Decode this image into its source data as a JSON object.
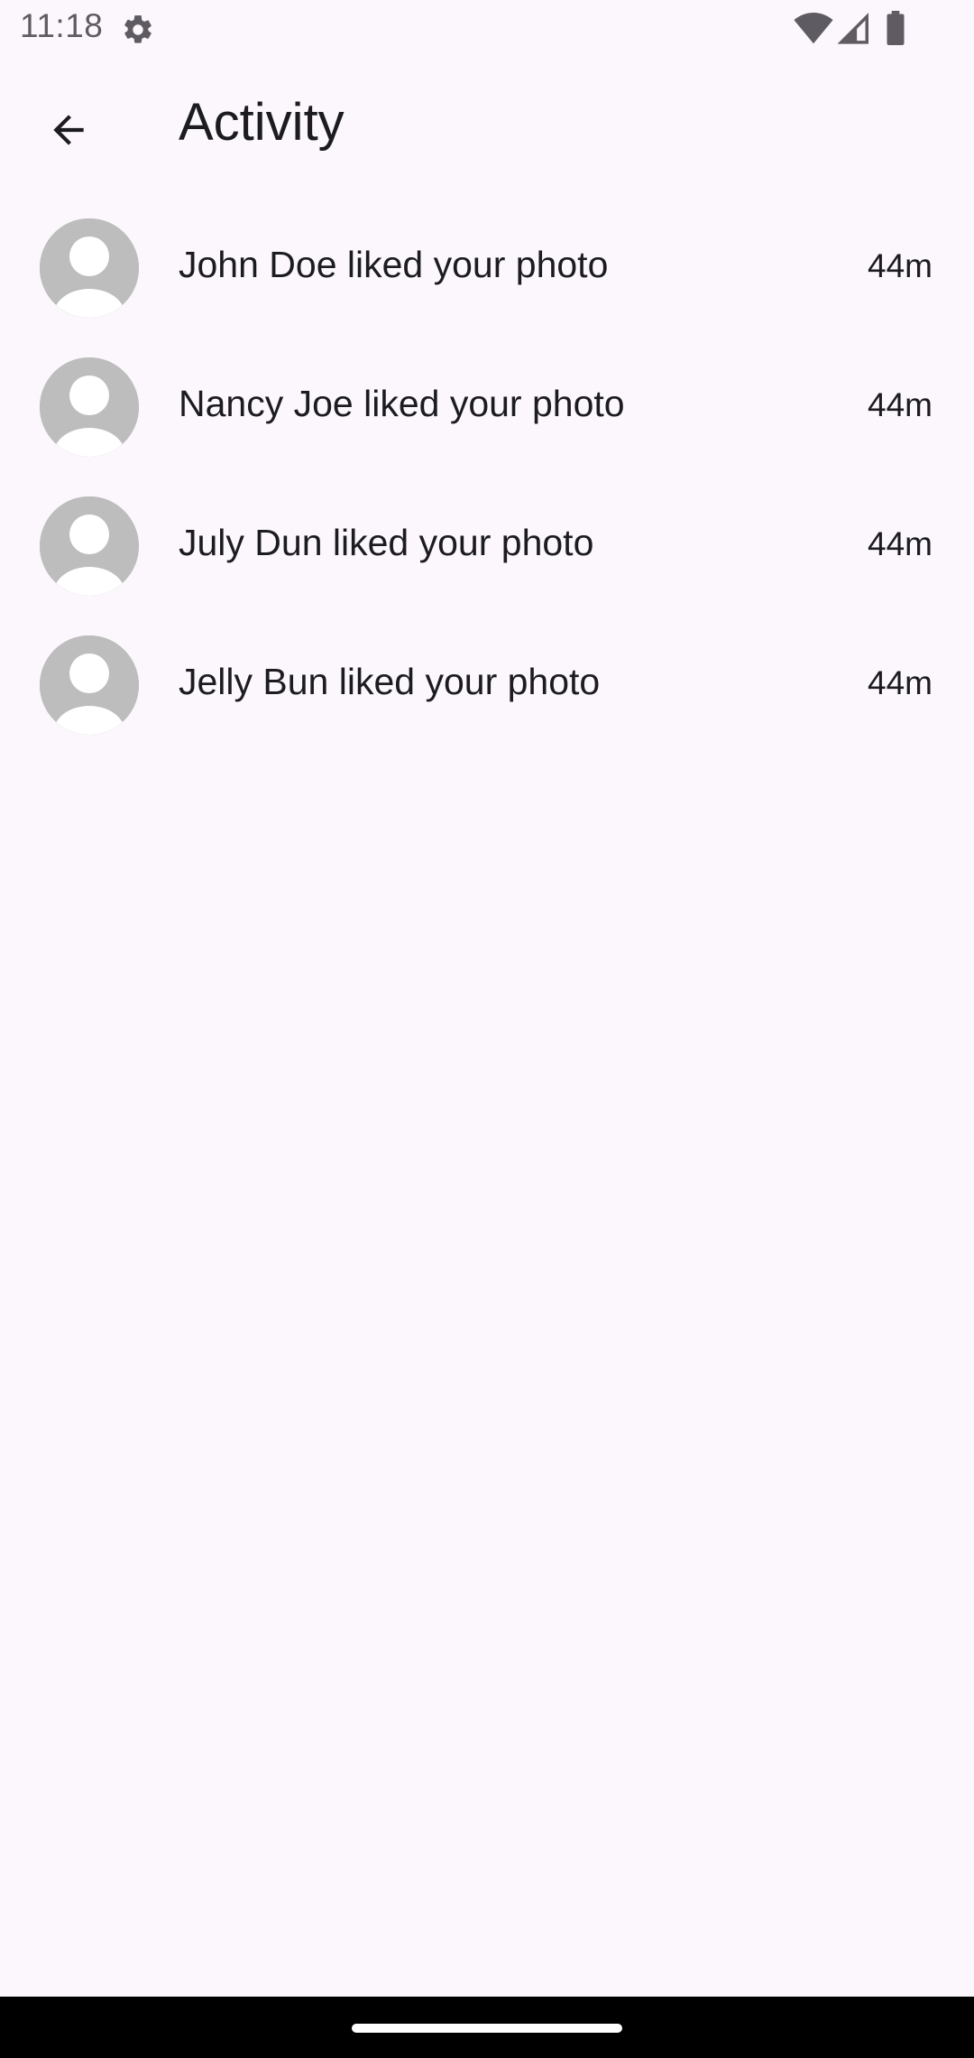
{
  "status_bar": {
    "time": "11:18",
    "icons": [
      "gear-icon",
      "wifi-icon",
      "signal-icon",
      "battery-icon"
    ]
  },
  "app_bar": {
    "title": "Activity",
    "back_icon": "arrow-left-icon"
  },
  "activities": [
    {
      "text": "John Doe liked your photo",
      "time": "44m",
      "avatar": "default-user-avatar"
    },
    {
      "text": "Nancy Joe liked your photo",
      "time": "44m",
      "avatar": "default-user-avatar"
    },
    {
      "text": "July Dun liked your photo",
      "time": "44m",
      "avatar": "default-user-avatar"
    },
    {
      "text": "Jelly Bun liked your photo",
      "time": "44m",
      "avatar": "default-user-avatar"
    }
  ],
  "colors": {
    "background": "#fbf7fc",
    "avatar_bg": "#bdbdbd",
    "text": "#1c1b1f"
  }
}
